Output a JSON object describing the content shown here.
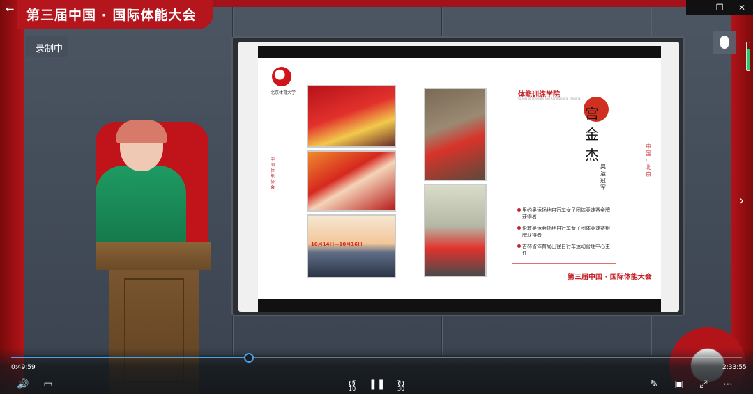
{
  "app": {
    "window_title": "第三届中国 · 国际体能大会",
    "window_controls": [
      "—",
      "❐",
      "✕"
    ],
    "back_icon": "back-arrow-icon"
  },
  "overlay": {
    "recording_label": "录制中"
  },
  "slide": {
    "logo_caption": "北京体育大学",
    "left_vertical_text": "中国体能协会",
    "poster_text": "10月14日—10月16日",
    "card": {
      "academy_name": "体能训练学院",
      "academy_subtitle": "School of Strength and Conditioning Training",
      "name_chars": [
        "宫",
        "金",
        "杰"
      ],
      "honor": "奥运冠军",
      "bullets": [
        "里约奥运场地自行车女子团体竞速赛金牌获得者",
        "伦敦奥运会场地自行车女子团体竞速赛银牌获得者",
        "吉林省体育局田径自行车运动管理中心主任"
      ]
    },
    "location_vertical": "中国·北京",
    "footer": "第三届中国 · 国际体能大会"
  },
  "player": {
    "current_time": "0:49:59",
    "total_time": "2:33:55",
    "progress_fraction": 0.325,
    "rewind_seconds": "10",
    "forward_seconds": "30",
    "accent_color": "#4aa3e8",
    "icons": {
      "volume": "volume-icon",
      "captions": "captions-icon",
      "rewind": "rewind-10-icon",
      "pause": "pause-icon",
      "forward": "forward-30-icon",
      "edit": "pen-icon",
      "miniplayer": "miniplayer-icon",
      "fullscreen": "fullscreen-icon",
      "more": "more-icon"
    }
  },
  "brand_color": "#b5161d"
}
